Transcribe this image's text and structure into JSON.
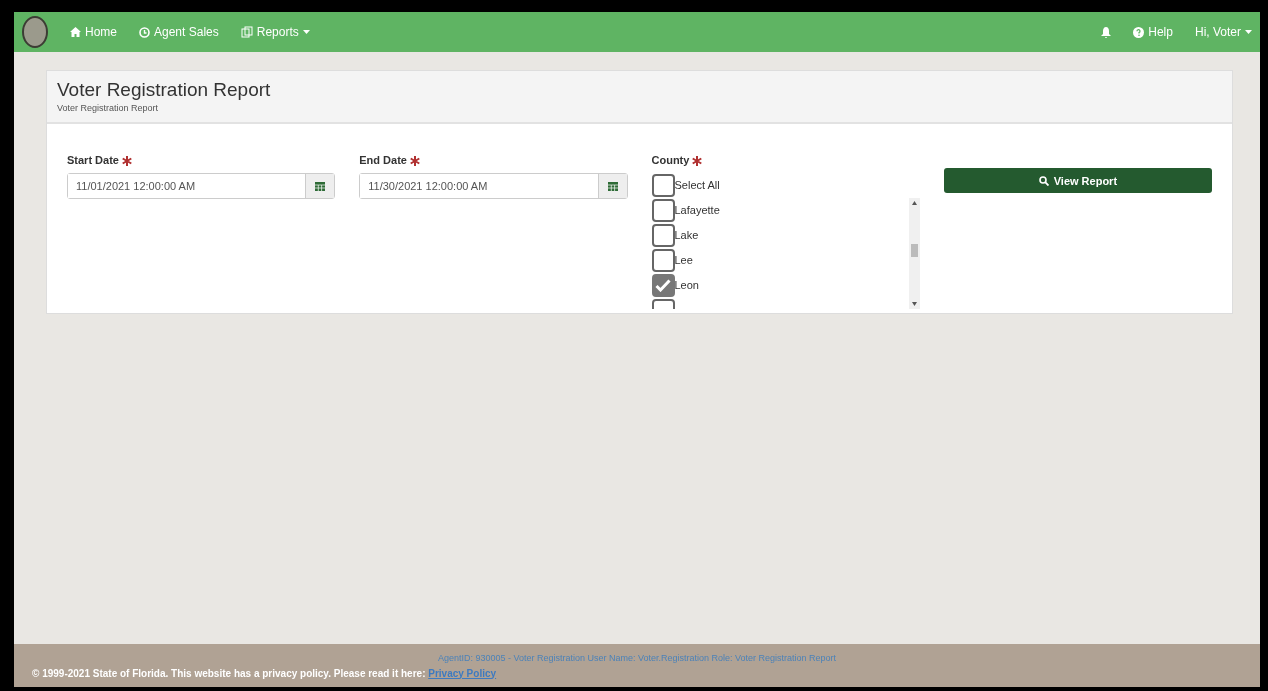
{
  "navbar": {
    "items": [
      {
        "label": "Home",
        "kind": "home"
      },
      {
        "label": "Agent Sales",
        "kind": "clock"
      },
      {
        "label": "Reports",
        "kind": "reports",
        "dropdown": true
      }
    ],
    "right": [
      {
        "kind": "bell"
      },
      {
        "label": "Help",
        "kind": "help"
      },
      {
        "label": "Hi, Voter",
        "kind": "user",
        "dropdown": true
      }
    ]
  },
  "header": {
    "title": "Voter Registration Report",
    "subtitle": "Voter Registration Report"
  },
  "form": {
    "start_date": {
      "label": "Start Date",
      "value": "11/01/2021 12:00:00 AM",
      "required": true
    },
    "end_date": {
      "label": "End Date",
      "value": "11/30/2021 12:00:00 AM",
      "required": true
    },
    "county": {
      "label": "County",
      "required": true,
      "select_all": {
        "label": "Select All",
        "checked": false
      },
      "options": [
        {
          "label": "Lafayette",
          "checked": false
        },
        {
          "label": "Lake",
          "checked": false
        },
        {
          "label": "Lee",
          "checked": false
        },
        {
          "label": "Leon",
          "checked": true
        },
        {
          "checked": false
        }
      ]
    },
    "button": "View Report"
  },
  "footer": {
    "info": "AgentID: 930005 - Voter Registration User Name: Voter.Registration Role: Voter Registration Report",
    "copyright": "© 1999-2021 State of Florida. This website has a privacy policy. Please read it here:",
    "link": "Privacy Policy"
  }
}
